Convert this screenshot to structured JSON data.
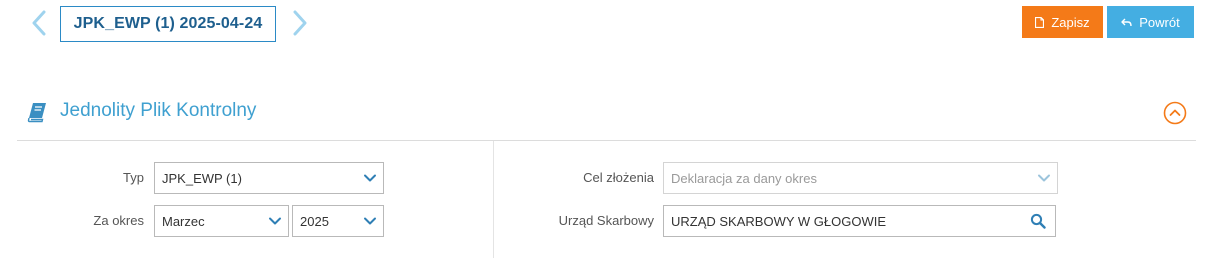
{
  "header": {
    "document_title": "JPK_EWP (1) 2025-04-24",
    "save_label": "Zapisz",
    "back_label": "Powrót"
  },
  "section": {
    "title": "Jednolity Plik Kontrolny"
  },
  "form": {
    "type_label": "Typ",
    "type_value": "JPK_EWP (1)",
    "period_label": "Za okres",
    "month_value": "Marzec",
    "year_value": "2025",
    "purpose_label": "Cel złożenia",
    "purpose_value": "Deklaracja za dany okres",
    "office_label": "Urząd Skarbowy",
    "office_value": "URZĄD SKARBOWY W GŁOGOWIE"
  },
  "colors": {
    "accent_blue": "#44aee2",
    "title_blue": "#1e5f8e",
    "save_orange": "#f47a18"
  },
  "icons": [
    "chevron-left-icon",
    "chevron-right-icon",
    "file-icon",
    "reply-arrow-icon",
    "book-icon",
    "chevron-up-circle-icon",
    "chevron-down-icon",
    "search-icon"
  ]
}
